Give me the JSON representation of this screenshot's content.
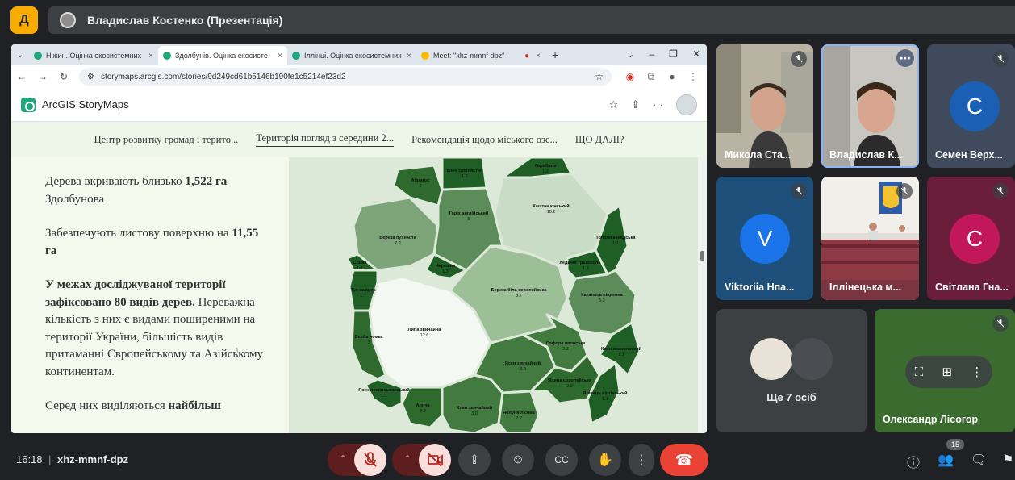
{
  "app": {
    "logo_letter": "Д",
    "presentation_title": "Владислав Костенко (Презентація)"
  },
  "browser": {
    "tabs": [
      {
        "label": "Ніжин. Оцінка екосистемних"
      },
      {
        "label": "Здолбунів. Оцінка екосисте"
      },
      {
        "label": "Іллінці. Оцінка екосистемних"
      },
      {
        "label": "Meet: \"xhz-mmnf-dpz\""
      }
    ],
    "url": "storymaps.arcgis.com/stories/9d249cd61b5146b190fe1c5214ef23d2"
  },
  "storymap": {
    "brand": "ArcGIS StoryMaps",
    "nav": [
      "Центр розвитку громад і терито...",
      "Територія погляд з середини 2...",
      "Рекомендація щодо міського озе...",
      "ЩО ДАЛІ?"
    ],
    "paragraphs": {
      "p1_pre": "Дерева вкривають близько ",
      "p1_bold": "1,522 га",
      "p1_post": " Здолбунова",
      "p2_pre": "Забезпечують листову поверхню на ",
      "p2_bold": "11,55 га",
      "p3_bold": "У межах досліджуваної території зафіксовано 80 видів дерев.",
      "p3_post": " Переважна кількість з них є видами поширеними на території України, більшість видів притаманні Європейському та Азійському континентам.",
      "p4_pre": "Серед них виділяються ",
      "p4_bold": "найбільш"
    }
  },
  "voronoi": [
    {
      "label": "Липа звичайна",
      "value": "12.6",
      "color": "#f4f8f2"
    },
    {
      "label": "Каштан кінський",
      "value": "10.2",
      "color": "#c9dcc6"
    },
    {
      "label": "Береза біла європейська",
      "value": "8.7",
      "color": "#9cbf98"
    },
    {
      "label": "Береза пухнаста",
      "value": "7.2",
      "color": "#7ea57a"
    },
    {
      "label": "Горіх англійський",
      "value": "5",
      "color": "#5c8c59"
    },
    {
      "label": "Катальпа південна",
      "value": "5.2",
      "color": "#5c8c59"
    },
    {
      "label": "Ясен звичайний",
      "value": "3.8",
      "color": "#427a40"
    },
    {
      "label": "Клен звичайний",
      "value": "3.0",
      "color": "#427a40"
    },
    {
      "label": "Вербa ломка",
      "value": "3",
      "color": "#2e6a2e"
    },
    {
      "label": "Софора японська",
      "value": "2.3",
      "color": "#427a40"
    },
    {
      "label": "Яблуня лісова",
      "value": "2.2",
      "color": "#427a40"
    },
    {
      "label": "Ялина європейська",
      "value": "2.2",
      "color": "#2e6a2e"
    },
    {
      "label": "Алича",
      "value": "2.2",
      "color": "#2e6a2e"
    },
    {
      "label": "Абрикос",
      "value": "2",
      "color": "#2e6a2e"
    },
    {
      "label": "Клен сріблястий",
      "value": "1.3",
      "color": "#1f5e24"
    },
    {
      "label": "Черешня",
      "value": "1.3",
      "color": "#1f5e24"
    },
    {
      "label": "Гледичія трьохколючкова",
      "value": "1.3",
      "color": "#1f5e24"
    },
    {
      "label": "Тополя канадська",
      "value": "1.1",
      "color": "#1f5e24"
    },
    {
      "label": "Туя західна",
      "value": "1.1",
      "color": "#1f5e24"
    },
    {
      "label": "Ясен пенсильванський",
      "value": "1.1",
      "color": "#1f5e24"
    },
    {
      "label": "Ялівець віргінський",
      "value": "1.1",
      "color": "#1f5e24"
    },
    {
      "label": "Клен ясенолистий",
      "value": "1.1",
      "color": "#1f5e24"
    },
    {
      "label": "Горобина",
      "value": "1.2",
      "color": "#1f5e24"
    },
    {
      "label": "Слива",
      "value": "1.1",
      "color": "#1f5e24"
    }
  ],
  "participants": [
    {
      "name": "Микола Ста..."
    },
    {
      "name": "Владислав К..."
    },
    {
      "name": "Семен Верх...",
      "initial": "С",
      "color": "#1a5fb4"
    },
    {
      "name": "Viktoriia Нпа...",
      "initial": "V",
      "color": "#1a73e8"
    },
    {
      "name": "Іллінецька м..."
    },
    {
      "name": "Світлана Гна...",
      "initial": "С",
      "color": "#c2185b"
    },
    {
      "name": "Олександр Лісогор"
    }
  ],
  "others_label": "Ще 7 осіб",
  "bottom": {
    "time": "16:18",
    "separator": "|",
    "meeting_code": "xhz-mmnf-dpz",
    "participant_count": "15"
  },
  "colors": {
    "meet_dark": "#202124",
    "danger": "#ea4335",
    "accent": "#8ab4f8"
  }
}
